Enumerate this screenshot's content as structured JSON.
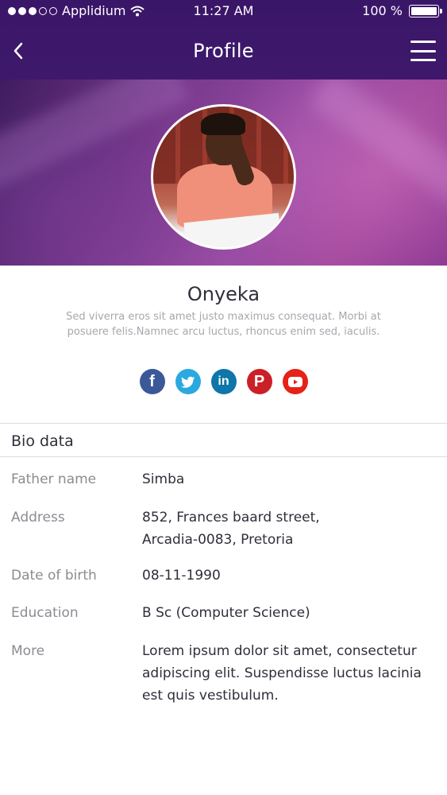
{
  "status_bar": {
    "carrier": "Applidium",
    "time": "11:27 AM",
    "battery": "100 %",
    "battery_level": 1.0,
    "signal_dots_filled": 3,
    "signal_dots_total": 5
  },
  "nav": {
    "title": "Profile",
    "back_icon": "chevron-left-icon",
    "menu_icon": "hamburger-menu-icon"
  },
  "profile": {
    "name": "Onyeka",
    "about": "Sed viverra eros sit amet justo maximus consequat. Morbi at posuere felis.Namnec arcu luctus, rhoncus enim sed, iaculis."
  },
  "social": [
    {
      "icon": "facebook-icon",
      "glyph": "f",
      "color": "#3b5998"
    },
    {
      "icon": "twitter-icon",
      "glyph": "",
      "color": "#2aa9e0"
    },
    {
      "icon": "linkedin-icon",
      "glyph": "in",
      "color": "#0e76a8"
    },
    {
      "icon": "pinterest-icon",
      "glyph": "P",
      "color": "#cb2027"
    },
    {
      "icon": "youtube-icon",
      "glyph": "",
      "color": "#e62117"
    }
  ],
  "bio": {
    "title": "Bio data",
    "rows": [
      {
        "label": "Father name",
        "value": "Simba"
      },
      {
        "label": "Address",
        "value": "852, Frances baard street, Arcadia-0083, Pretoria"
      },
      {
        "label": "Date of birth",
        "value": "08-11-1990"
      },
      {
        "label": "Education",
        "value": "B Sc (Computer Science)"
      },
      {
        "label": "More",
        "value": "Lorem ipsum dolor sit amet, consectetur adipiscing elit. Suspendisse luctus lacinia est quis vestibulum."
      }
    ]
  },
  "colors": {
    "header_bg": "#3f186c",
    "text_primary": "#2f2f3b",
    "text_secondary": "#8b8b93"
  }
}
